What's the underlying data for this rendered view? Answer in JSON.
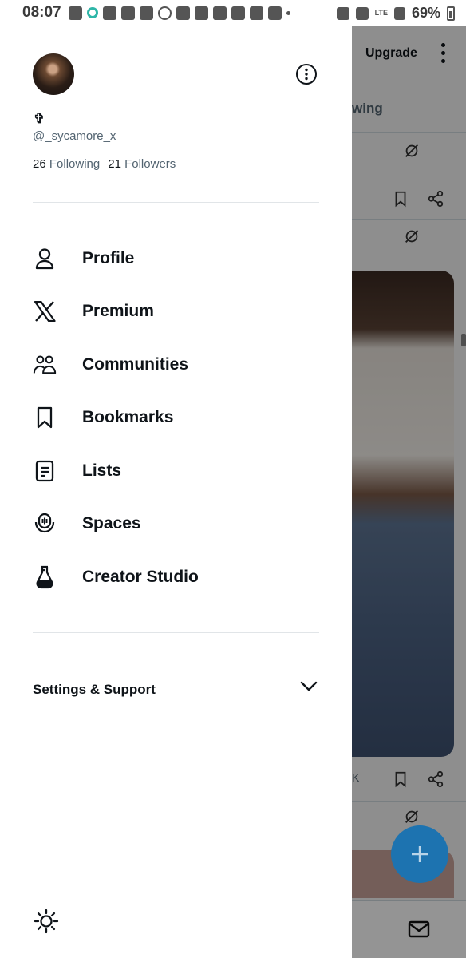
{
  "status_bar": {
    "time": "08:07",
    "battery": "69%",
    "network": "LTE"
  },
  "drawer": {
    "display_name": "✞",
    "handle": "@_sycamore_x",
    "following_count": "26",
    "following_label": "Following",
    "followers_count": "21",
    "followers_label": "Followers",
    "menu": [
      {
        "label": "Profile",
        "icon": "person-icon"
      },
      {
        "label": "Premium",
        "icon": "x-logo-icon"
      },
      {
        "label": "Communities",
        "icon": "communities-icon"
      },
      {
        "label": "Bookmarks",
        "icon": "bookmark-icon"
      },
      {
        "label": "Lists",
        "icon": "list-icon"
      },
      {
        "label": "Spaces",
        "icon": "spaces-icon"
      },
      {
        "label": "Creator Studio",
        "icon": "flask-icon"
      }
    ],
    "settings_label": "Settings & Support"
  },
  "background": {
    "upgrade_label": "Upgrade",
    "tab_label_fragment": "wing",
    "count_fragment": "K"
  },
  "colors": {
    "accent_fab": "#1d73b0",
    "text_primary": "#0f1419",
    "text_secondary": "#536471"
  }
}
